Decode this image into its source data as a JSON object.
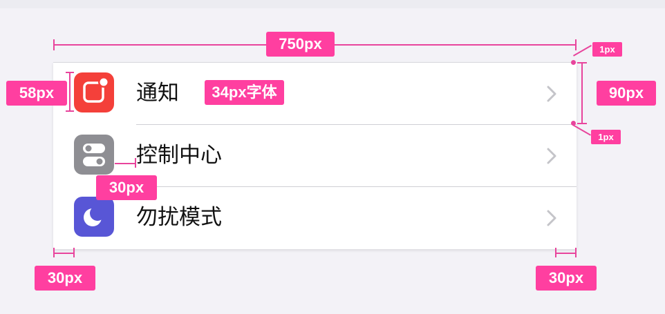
{
  "settings": {
    "items": [
      {
        "label": "通知",
        "icon": "notification-icon",
        "color": "#f4403a"
      },
      {
        "label": "控制中心",
        "icon": "control-center-icon",
        "color": "#8e8e93"
      },
      {
        "label": "勿扰模式",
        "icon": "moon-icon",
        "color": "#5856d6"
      }
    ],
    "chevron_icon": "chevron-right-icon"
  },
  "annotations": {
    "width_label": "750px",
    "icon_size_label": "58px",
    "font_label": "34px字体",
    "row_height_label": "90px",
    "border_top_label": "1px",
    "border_bottom_label": "1px",
    "gap_label": "30px",
    "left_margin_label": "30px",
    "right_margin_label": "30px",
    "accent_color": "#ff3fa0"
  }
}
